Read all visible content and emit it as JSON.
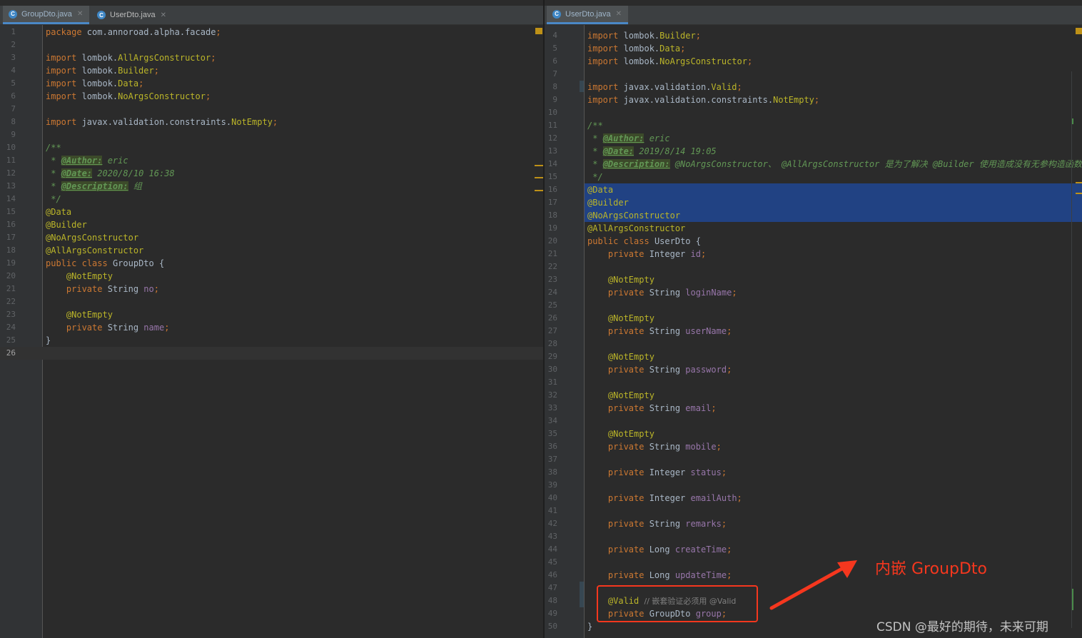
{
  "left_tabs": [
    {
      "label": "GroupDto.java",
      "active": true
    },
    {
      "label": "UserDto.java",
      "active": false
    }
  ],
  "right_tabs": [
    {
      "label": "UserDto.java",
      "active": true
    }
  ],
  "left_code": [
    "package com.annoroad.alpha.facade;",
    "",
    "import lombok.AllArgsConstructor;",
    "import lombok.Builder;",
    "import lombok.Data;",
    "import lombok.NoArgsConstructor;",
    "",
    "import javax.validation.constraints.NotEmpty;",
    "",
    "/**",
    " * @Author: eric",
    " * @Date: 2020/8/10 16:38",
    " * @Description: 组",
    " */",
    "@Data",
    "@Builder",
    "@NoArgsConstructor",
    "@AllArgsConstructor",
    "public class GroupDto {",
    "    @NotEmpty",
    "    private String no;",
    "",
    "    @NotEmpty",
    "    private String name;",
    "}",
    ""
  ],
  "right_code": [
    "import lombok.Builder;",
    "import lombok.Data;",
    "import lombok.NoArgsConstructor;",
    "",
    "import javax.validation.Valid;",
    "import javax.validation.constraints.NotEmpty;",
    "",
    "/**",
    " * @Author: eric",
    " * @Date: 2019/8/14 19:05",
    " * @Description: @NoArgsConstructor、 @AllArgsConstructor 是为了解决 @Builder 使用造成没有无参构造函数的问题",
    " */",
    "@Data",
    "@Builder",
    "@NoArgsConstructor",
    "@AllArgsConstructor",
    "public class UserDto {",
    "    private Integer id;",
    "",
    "    @NotEmpty",
    "    private String loginName;",
    "",
    "    @NotEmpty",
    "    private String userName;",
    "",
    "    @NotEmpty",
    "    private String password;",
    "",
    "    @NotEmpty",
    "    private String email;",
    "",
    "    @NotEmpty",
    "    private String mobile;",
    "",
    "    private Integer status;",
    "",
    "    private Integer emailAuth;",
    "",
    "    private String remarks;",
    "",
    "    private Long createTime;",
    "",
    "    private Long updateTime;",
    "",
    "    @Valid // 嵌套验证必须用 @Valid",
    "    private GroupDto group;",
    "}"
  ],
  "right_first_line_number": 4,
  "left_current_line": 26,
  "right_current_line": 16,
  "annotation_note": "内嵌 GroupDto",
  "watermark": "CSDN @最好的期待，未来可期"
}
